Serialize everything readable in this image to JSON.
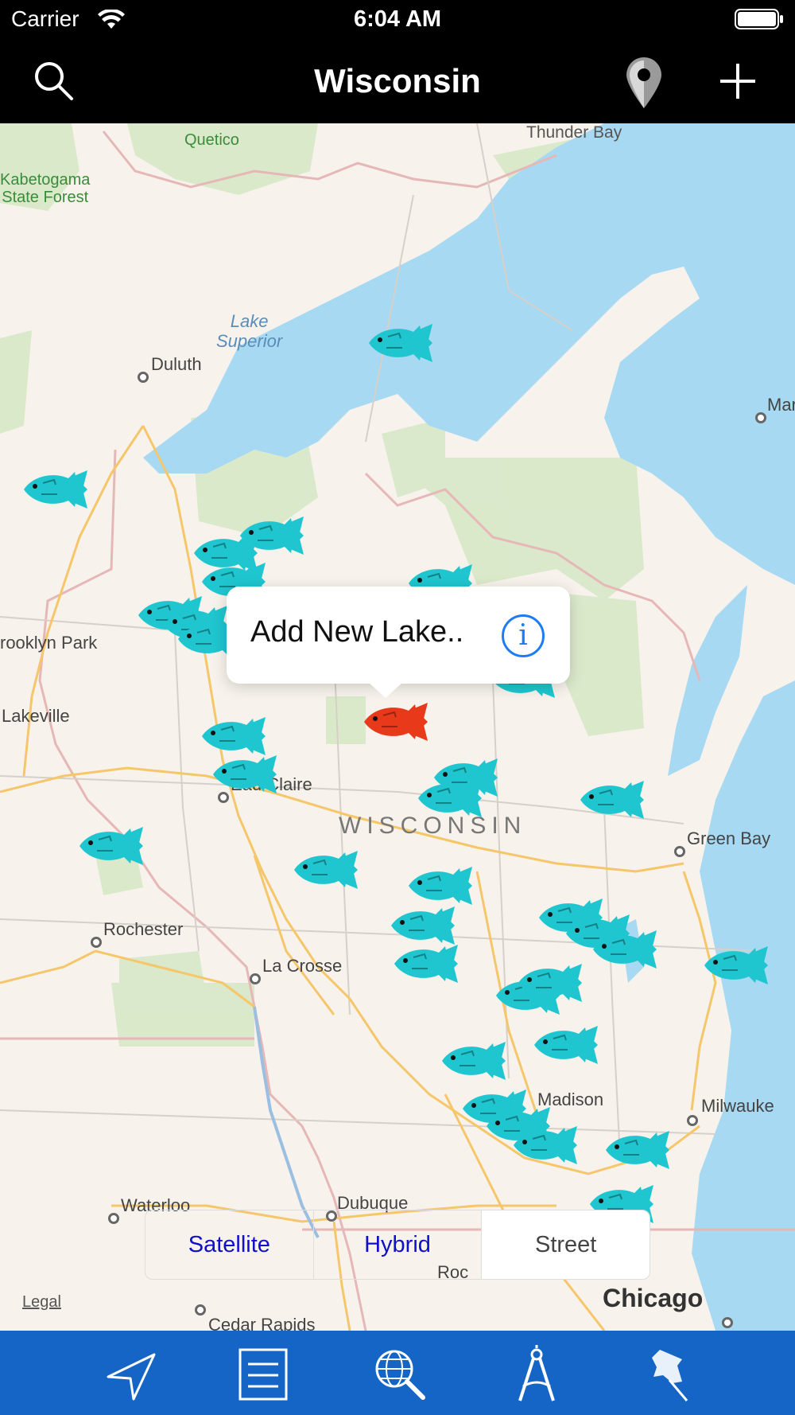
{
  "status_bar": {
    "carrier": "Carrier",
    "time": "6:04 AM"
  },
  "nav": {
    "title": "Wisconsin",
    "left_icon": "search-icon",
    "right_icons": [
      "pin-icon",
      "plus-icon"
    ]
  },
  "map": {
    "labels": {
      "quetico": "Quetico",
      "kabetogama": "Kabetogama\nState Forest",
      "thunder_bay": "Thunder Bay",
      "lake_superior": "Lake\nSuperior",
      "duluth": "Duluth",
      "marquette": "Mar",
      "brooklyn_park": "rooklyn Park",
      "lakeville": "Lakeville",
      "eau_claire": "Eau Claire",
      "wisconsin": "WISCONSIN",
      "green_bay": "Green Bay",
      "rochester": "Rochester",
      "la_crosse": "La Crosse",
      "madison": "Madison",
      "milwaukee": "Milwauke",
      "waterloo": "Waterloo",
      "dubuque": "Dubuque",
      "rockford": "Roc",
      "chicago": "Chicago",
      "cedar_rapids": "Cedar Rapids"
    },
    "fish_marker_color": "#1fc6cf",
    "selected_marker_color": "#e83a1a"
  },
  "callout": {
    "title": "Add New Lake..",
    "icon": "info-icon"
  },
  "map_type": {
    "options": [
      "Satellite",
      "Hybrid",
      "Street"
    ],
    "selected": "Street"
  },
  "legal": "Legal",
  "tab_bar": {
    "icons": [
      "location-arrow-icon",
      "list-icon",
      "globe-search-icon",
      "compass-drafting-icon",
      "pushpin-icon"
    ]
  }
}
